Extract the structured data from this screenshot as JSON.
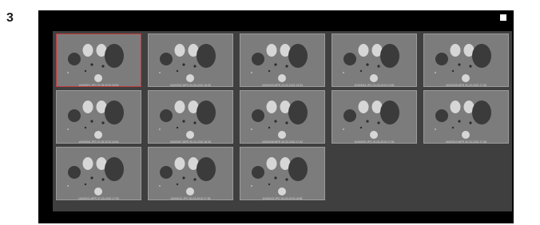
{
  "step": {
    "number": "3"
  },
  "toolbar": {
    "save_icon": "save-icon",
    "pin_icon": "pin-icon"
  },
  "colors": {
    "screen_bg": "#000000",
    "grid_bg": "#3f3f3f",
    "thumb_bg": "#7c7c7c",
    "selected_border": "#c23a3a"
  },
  "thumbnails": [
    {
      "caption": "IA000001.JPG 07-05-2015 18:53",
      "selected": true
    },
    {
      "caption": "IA000002.MPR 03-06-2015 18:35",
      "selected": false
    },
    {
      "caption": "IA000003.MPR 22-02-2015 13:53",
      "selected": false
    },
    {
      "caption": "IA000004.JPG 21-03-2015 13:55",
      "selected": false
    },
    {
      "caption": "IA000005.MPR 30-03-2015 17:35",
      "selected": false
    },
    {
      "caption": "IA000006.JPG 07-06-2015 16:53",
      "selected": false
    },
    {
      "caption": "IA000007.MPR 30-03-2015 18:35",
      "selected": false
    },
    {
      "caption": "IA000008.MPR 30-03-2015 17:32",
      "selected": false
    },
    {
      "caption": "IA000009.JPG 30-05-2015 17:55",
      "selected": false
    },
    {
      "caption": "IA000010.MPR 30-03-2015 17:48",
      "selected": false
    },
    {
      "caption": "IA000011.MPR 07-03-2015 17:53",
      "selected": false
    },
    {
      "caption": "IA000012.JPG 30-03-2015 17:35",
      "selected": false
    },
    {
      "caption": "IA000013.JPG 30-03-2015 18:58",
      "selected": false
    }
  ]
}
